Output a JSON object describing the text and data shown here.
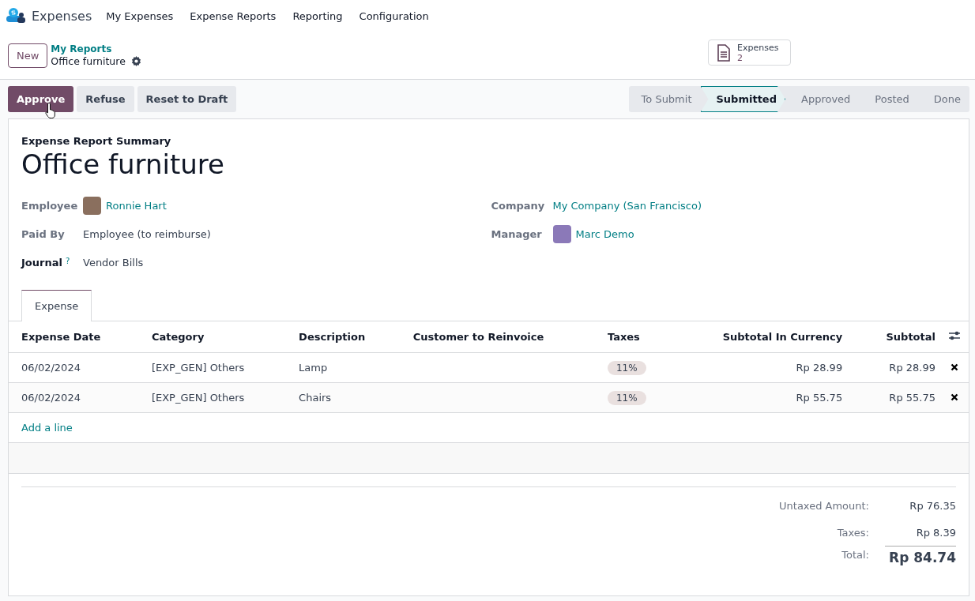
{
  "nav": {
    "app": "Expenses",
    "menu": [
      "My Expenses",
      "Expense Reports",
      "Reporting",
      "Configuration"
    ]
  },
  "control": {
    "new": "New",
    "breadcrumb": "My Reports",
    "record": "Office furniture",
    "smart_button": {
      "label": "Expenses",
      "count": "2"
    }
  },
  "actions": [
    {
      "label": "Approve",
      "kind": "primary"
    },
    {
      "label": "Refuse",
      "kind": "secondary"
    },
    {
      "label": "Reset to Draft",
      "kind": "secondary"
    }
  ],
  "stages": [
    {
      "label": "To Submit",
      "selected": false
    },
    {
      "label": "Submitted",
      "selected": true
    },
    {
      "label": "Approved",
      "selected": false
    },
    {
      "label": "Posted",
      "selected": false
    },
    {
      "label": "Done",
      "selected": false
    }
  ],
  "sheet": {
    "subtitle": "Expense Report Summary",
    "title": "Office furniture",
    "left_fields": [
      {
        "label": "Employee",
        "value": "Ronnie Hart",
        "kind": "person"
      },
      {
        "label": "Paid By",
        "value": "Employee (to reimburse)",
        "kind": "text"
      },
      {
        "label": "Journal",
        "help": "?",
        "value": "Vendor Bills",
        "kind": "text"
      }
    ],
    "right_fields": [
      {
        "label": "Company",
        "value": "My Company (San Francisco)",
        "kind": "link"
      },
      {
        "label": "Manager",
        "value": "Marc Demo",
        "kind": "person"
      }
    ],
    "tabs": [
      {
        "label": "Expense",
        "selected": true
      }
    ]
  },
  "table": {
    "columns": [
      "Expense Date",
      "Category",
      "Description",
      "Customer to Reinvoice",
      "Taxes",
      "Subtotal In Currency",
      "Subtotal"
    ],
    "rows": [
      {
        "date": "06/02/2024",
        "category": "[EXP_GEN] Others",
        "description": "Lamp",
        "tax": "11%",
        "subtotal_currency": "Rp 28.99",
        "subtotal": "Rp 28.99"
      },
      {
        "date": "06/02/2024",
        "category": "[EXP_GEN] Others",
        "description": "Chairs",
        "tax": "11%",
        "subtotal_currency": "Rp 55.75",
        "subtotal": "Rp 55.75"
      }
    ],
    "add_line": "Add a line"
  },
  "totals": [
    {
      "label": "Untaxed Amount:",
      "value": "Rp 76.35",
      "kind": "normal"
    },
    {
      "label": "Taxes:",
      "value": "Rp 8.39",
      "kind": "normal"
    },
    {
      "label": "Total:",
      "value": "Rp 84.74",
      "kind": "grand"
    }
  ]
}
